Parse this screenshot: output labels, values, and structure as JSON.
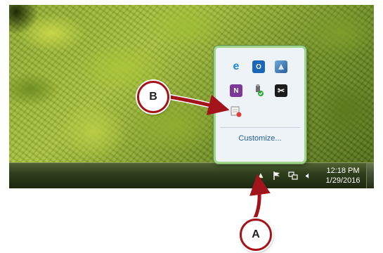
{
  "taskbar": {
    "clock": {
      "time": "12:18 PM",
      "date": "1/29/2016"
    },
    "icons": [
      "show-hidden-icons-arrow-icon",
      "action-center-flag-icon",
      "network-icon",
      "volume-icon"
    ]
  },
  "tray_popup": {
    "icons": [
      "ie-icon",
      "outlook-icon",
      "app-icon",
      "onenote-icon",
      "usb-safely-remove-icon",
      "snipping-tool-icon",
      "calendar-app-icon"
    ],
    "customize_label": "Customize..."
  },
  "callouts": {
    "a_label": "A",
    "b_label": "B"
  },
  "colors": {
    "callout_border": "#a3131a",
    "arrow": "#a3131a",
    "popup_border": "#9fd48a",
    "link": "#1f5f9f"
  }
}
